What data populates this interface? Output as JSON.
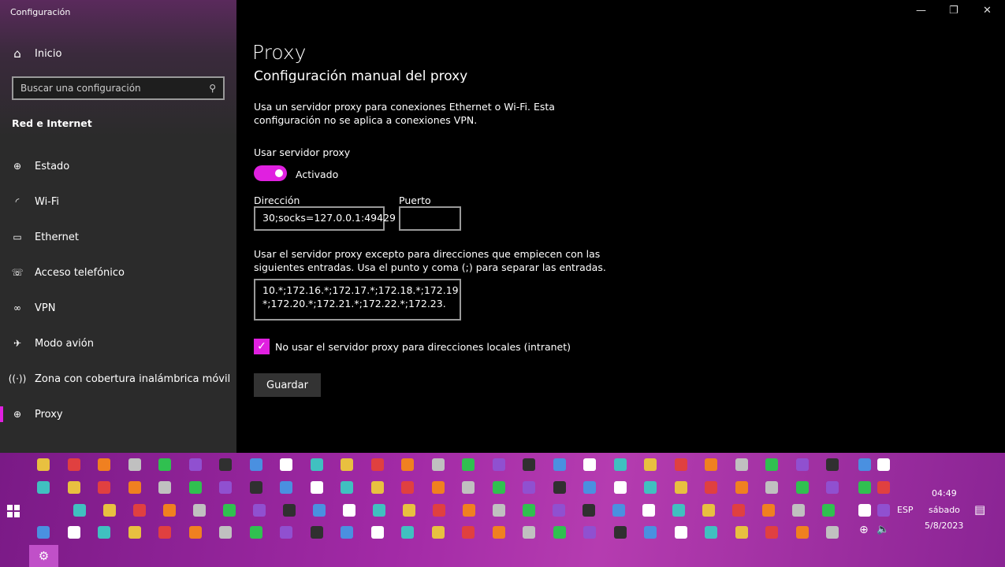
{
  "window": {
    "title": "Configuración",
    "minimize": "—",
    "restore": "❐",
    "close": "✕"
  },
  "sidebar": {
    "home": "Inicio",
    "search_placeholder": "Buscar una configuración",
    "section": "Red e Internet",
    "items": [
      {
        "label": "Estado",
        "icon": "⊕"
      },
      {
        "label": "Wi-Fi",
        "icon": "◜"
      },
      {
        "label": "Ethernet",
        "icon": "▭"
      },
      {
        "label": "Acceso telefónico",
        "icon": "☏"
      },
      {
        "label": "VPN",
        "icon": "∞"
      },
      {
        "label": "Modo avión",
        "icon": "✈"
      },
      {
        "label": "Zona con cobertura inalámbrica móvil",
        "icon": "((·))"
      },
      {
        "label": "Proxy",
        "icon": "⊕",
        "selected": true
      }
    ]
  },
  "main": {
    "title": "Proxy",
    "subtitle": "Configuración manual del proxy",
    "description": [
      "Usa un servidor proxy para conexiones Ethernet o Wi-Fi. Esta",
      "configuración no se aplica a conexiones VPN."
    ],
    "use_proxy_label": "Usar servidor proxy",
    "toggle_state": "Activado",
    "toggle_on": true,
    "address_label": "Dirección",
    "address_value": "30;socks=127.0.0.1:49429",
    "port_label": "Puerto",
    "port_value": "",
    "exceptions_label": [
      "Usar el servidor proxy excepto para direcciones que empiecen con las",
      "siguientes entradas. Usa el punto y coma (;) para separar las entradas."
    ],
    "exceptions_value": [
      "10.*;172.16.*;172.17.*;172.18.*;172.19.",
      "*;172.20.*;172.21.*;172.22.*;172.23."
    ],
    "local_checkbox_label": "No usar el servidor proxy para direcciones locales (intranet)",
    "local_checked": true,
    "save": "Guardar"
  },
  "colors": {
    "accent": "#e020e0",
    "taskbar": "#a22aa6"
  },
  "taskbar": {
    "tray": {
      "lang": "ESP",
      "time": "04:49",
      "day": "sábado",
      "date": "5/8/2023"
    },
    "icon_palette": [
      "#e8c040",
      "#4a90e0",
      "#30c050",
      "#e04040",
      "#ffffff",
      "#9050d0",
      "#f08020",
      "#40c0c0",
      "#303030",
      "#c0c0c0"
    ]
  }
}
